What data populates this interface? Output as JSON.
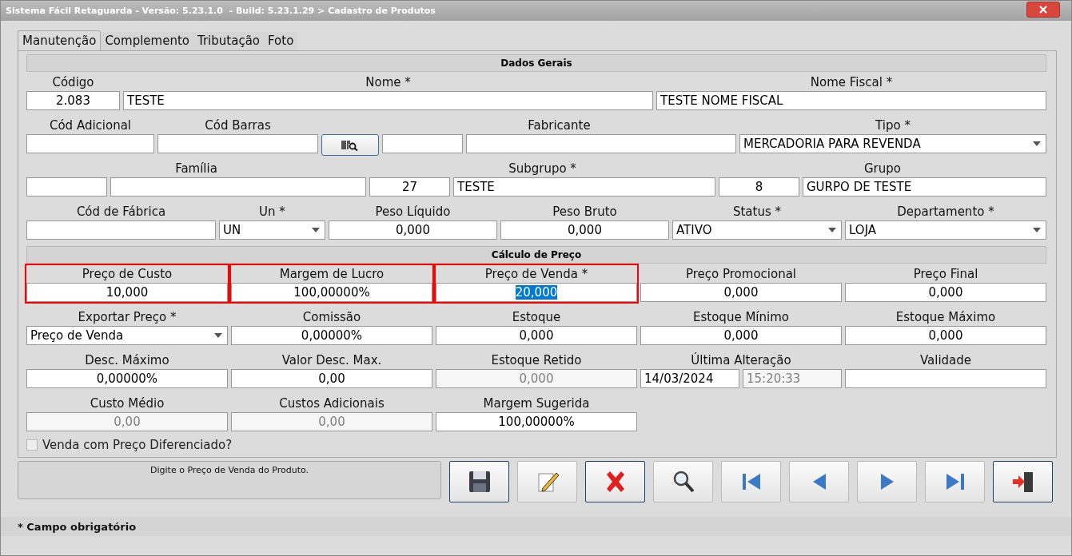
{
  "window": {
    "title": "Sistema Fácil Retaguarda - Versão: 5.23.1.0  - Build: 5.23.1.29 > Cadastro de Produtos"
  },
  "tabs": [
    {
      "label": "Manutenção",
      "selected": true
    },
    {
      "label": "Complemento",
      "selected": false
    },
    {
      "label": "Tributação",
      "selected": false
    },
    {
      "label": "Foto",
      "selected": false
    }
  ],
  "sections": [
    {
      "title": "Dados Gerais",
      "rows": [
        [
          {
            "label": "Código",
            "fields": [
              {
                "kind": "number",
                "value": "2.083"
              }
            ]
          },
          {
            "label": "Nome *",
            "fields": [
              {
                "kind": "text",
                "value": "TESTE"
              }
            ]
          },
          {
            "label": "Nome Fiscal *",
            "fields": [
              {
                "kind": "text",
                "value": "TESTE NOME FISCAL"
              }
            ]
          }
        ],
        [
          {
            "label": "Cód Adicional",
            "fields": [
              {
                "kind": "text"
              }
            ]
          },
          {
            "label": "Cód Barras",
            "fields": [
              {
                "kind": "text"
              }
            ]
          },
          {
            "fields": [
              {
                "kind": "button"
              }
            ]
          },
          {
            "label": "Fabricante",
            "fields": [
              {
                "kind": "code"
              },
              {
                "kind": "text"
              }
            ]
          },
          {
            "label": "Tipo *",
            "fields": [
              {
                "kind": "select",
                "value": "MERCADORIA PARA REVENDA"
              }
            ]
          }
        ],
        [
          {
            "label": "Família",
            "fields": [
              {
                "kind": "code"
              },
              {
                "kind": "text"
              }
            ]
          },
          {
            "label": "Subgrupo *",
            "fields": [
              {
                "kind": "code",
                "value": "27"
              },
              {
                "kind": "text",
                "value": "TESTE"
              }
            ]
          },
          {
            "label": "Grupo",
            "fields": [
              {
                "kind": "code",
                "value": "8"
              },
              {
                "kind": "text",
                "value": "GURPO DE TESTE"
              }
            ]
          }
        ],
        [
          {
            "label": "Cód de Fábrica",
            "fields": [
              {
                "kind": "text"
              }
            ]
          },
          {
            "label": "Un *",
            "fields": [
              {
                "kind": "select",
                "value": "UN"
              }
            ]
          },
          {
            "label": "Peso Líquido",
            "fields": [
              {
                "kind": "number",
                "value": "0,000"
              }
            ]
          },
          {
            "label": "Peso Bruto",
            "fields": [
              {
                "kind": "number",
                "value": "0,000"
              }
            ]
          },
          {
            "label": "Status *",
            "fields": [
              {
                "kind": "select",
                "value": "ATIVO"
              }
            ]
          },
          {
            "label": "Departamento *",
            "fields": [
              {
                "kind": "select",
                "value": "LOJA"
              }
            ]
          }
        ]
      ]
    },
    {
      "title": "Cálculo de Preço",
      "rows": [
        [
          {
            "label": "Preço de Custo",
            "highlighted": true,
            "fields": [
              {
                "kind": "number",
                "value": "10,000"
              }
            ]
          },
          {
            "label": "Margem de Lucro",
            "highlighted": true,
            "fields": [
              {
                "kind": "number",
                "value": "100,00000%"
              }
            ]
          },
          {
            "label": "Preço de Venda *",
            "highlighted": true,
            "fields": [
              {
                "kind": "number",
                "value": "20,000",
                "text_selected": true
              }
            ]
          },
          {
            "label": "Preço Promocional",
            "fields": [
              {
                "kind": "number",
                "value": "0,000"
              }
            ]
          },
          {
            "label": "Preço Final",
            "fields": [
              {
                "kind": "number",
                "value": "0,000"
              }
            ]
          }
        ],
        [
          {
            "label": "Exportar Preço *",
            "fields": [
              {
                "kind": "select",
                "value": "Preço de Venda"
              }
            ]
          },
          {
            "label": "Comissão",
            "fields": [
              {
                "kind": "number",
                "value": "0,00000%"
              }
            ]
          },
          {
            "label": "Estoque",
            "fields": [
              {
                "kind": "number",
                "value": "0,000"
              }
            ]
          },
          {
            "label": "Estoque Mínimo",
            "fields": [
              {
                "kind": "number",
                "value": "0,000"
              }
            ]
          },
          {
            "label": "Estoque Máximo",
            "fields": [
              {
                "kind": "number",
                "value": "0,000"
              }
            ]
          }
        ],
        [
          {
            "label": "Desc. Máximo",
            "fields": [
              {
                "kind": "number",
                "value": "0,00000%"
              }
            ]
          },
          {
            "label": "Valor Desc. Max.",
            "fields": [
              {
                "kind": "number",
                "value": "0,00"
              }
            ]
          },
          {
            "label": "Estoque Retido",
            "fields": [
              {
                "kind": "number",
                "value": "0,000",
                "disabled": true
              }
            ]
          },
          {
            "label": "Última Alteração",
            "fields": [
              {
                "kind": "text",
                "value": "14/03/2024"
              },
              {
                "kind": "text",
                "value": "15:20:33",
                "disabled": true
              }
            ]
          },
          {
            "label": "Validade",
            "fields": [
              {
                "kind": "text"
              }
            ]
          }
        ],
        [
          {
            "label": "Custo Médio",
            "fields": [
              {
                "kind": "number",
                "value": "0,00",
                "disabled": true
              }
            ]
          },
          {
            "label": "Custos Adicionais",
            "fields": [
              {
                "kind": "number",
                "value": "0,00",
                "disabled": true
              }
            ]
          },
          {
            "label": "Margem Sugerida",
            "fields": [
              {
                "kind": "number",
                "value": "100,00000%"
              }
            ]
          }
        ]
      ]
    }
  ],
  "checkbox": {
    "label": "Venda com Preço Diferenciado?",
    "checked": false
  },
  "status_message": "Digite o Preço de Venda do Produto.",
  "actions": [
    {
      "kind": "save",
      "outlined": true
    },
    {
      "kind": "edit",
      "outlined": false
    },
    {
      "kind": "delete",
      "outlined": true
    },
    {
      "kind": "search",
      "outlined": false
    },
    {
      "kind": "first",
      "outlined": false
    },
    {
      "kind": "previous",
      "outlined": false
    },
    {
      "kind": "next",
      "outlined": false
    },
    {
      "kind": "last",
      "outlined": false
    },
    {
      "kind": "exit",
      "outlined": true
    }
  ],
  "footer": "* Campo obrigatório"
}
